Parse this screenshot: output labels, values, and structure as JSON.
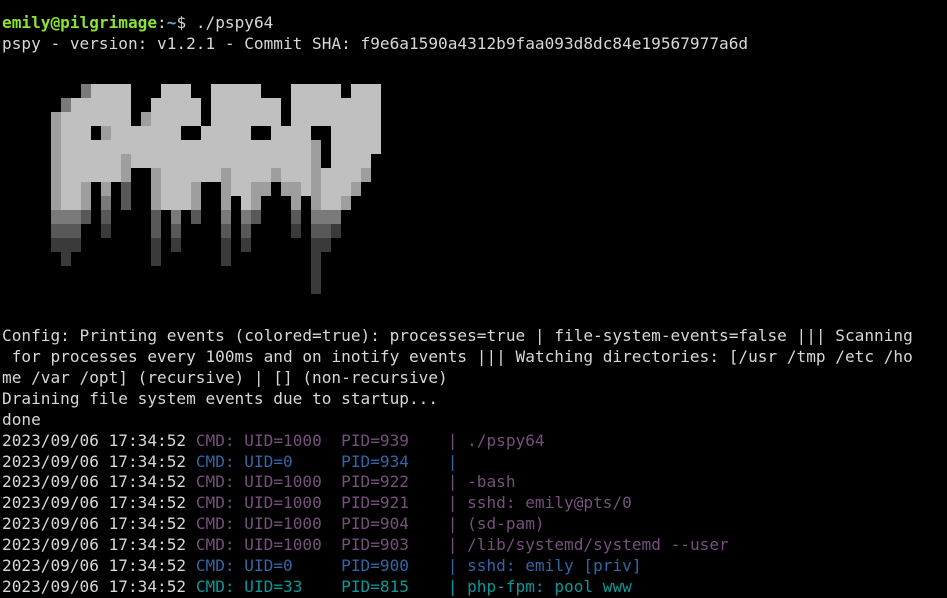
{
  "prompt": {
    "user_host": "emily@pilgrimage",
    "path": "~",
    "symbol": "$",
    "command": "./pspy64"
  },
  "version_line": "pspy - version: v1.2.1 - Commit SHA: f9e6a1590a4312b9faa093d8dc84e19567977a6d",
  "logo": {
    "name": "pspy-logo",
    "palette": {
      "a": "#3a3a3a",
      "b": "#585858",
      "c": "#7a7a7a",
      "d": "#9e9e9e",
      "e": "#c0c0c0"
    }
  },
  "config_lines": [
    "Config: Printing events (colored=true): processes=true | file-system-events=false ||| Scanning",
    " for processes every 100ms and on inotify events ||| Watching directories: [/usr /tmp /etc /ho",
    "me /var /opt] (recursive) | [] (non-recursive)",
    "Draining file system events due to startup...",
    "done"
  ],
  "colors": {
    "uid1000": "#75507b",
    "uid0": "#3465a4",
    "uid33": "#06989a",
    "prompt_user": "#8ae234",
    "prompt_path": "#729fcf"
  },
  "events": [
    {
      "ts": "2023/09/06 17:34:52",
      "text": "CMD: UID=1000  PID=939    | ./pspy64",
      "color": "uid1000"
    },
    {
      "ts": "2023/09/06 17:34:52",
      "text": "CMD: UID=0     PID=934    |",
      "color": "uid0"
    },
    {
      "ts": "2023/09/06 17:34:52",
      "text": "CMD: UID=1000  PID=922    | -bash",
      "color": "uid1000"
    },
    {
      "ts": "2023/09/06 17:34:52",
      "text": "CMD: UID=1000  PID=921    | sshd: emily@pts/0",
      "color": "uid1000"
    },
    {
      "ts": "2023/09/06 17:34:52",
      "text": "CMD: UID=1000  PID=904    | (sd-pam)",
      "color": "uid1000"
    },
    {
      "ts": "2023/09/06 17:34:52",
      "text": "CMD: UID=1000  PID=903    | /lib/systemd/systemd --user",
      "color": "uid1000"
    },
    {
      "ts": "2023/09/06 17:34:52",
      "text": "CMD: UID=0     PID=900    | sshd: emily [priv]",
      "color": "uid0"
    },
    {
      "ts": "2023/09/06 17:34:52",
      "text": "CMD: UID=33    PID=815    | php-fpm: pool www",
      "color": "uid33"
    }
  ]
}
